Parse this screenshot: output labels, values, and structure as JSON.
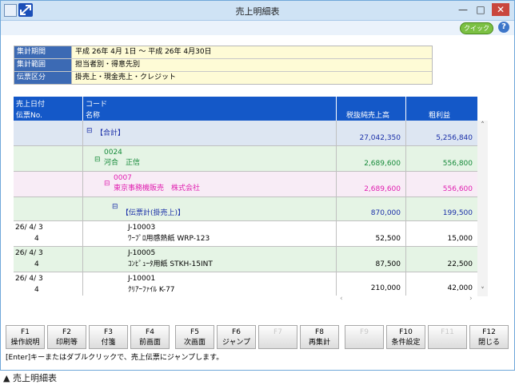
{
  "window": {
    "title": "売上明細表",
    "minimize": "—",
    "maximize": "□",
    "close": "✕",
    "quick_label": "クイック",
    "help_label": "?"
  },
  "info": [
    {
      "label": "集計期間",
      "value": "平成 26年 4月 1日 ～ 平成 26年 4月30日"
    },
    {
      "label": "集計範囲",
      "value": "担当者別・得意先別"
    },
    {
      "label": "伝票区分",
      "value": "掛売上・現金売上・クレジット"
    }
  ],
  "table": {
    "headers": {
      "col1_line1": "売上日付",
      "col1_line2": "伝票No.",
      "col2_line1": "コード",
      "col2_line2": "名称",
      "col3": "税抜純売上高",
      "col4": "粗利益"
    },
    "rows": [
      {
        "type": "group",
        "indent": 0,
        "code": "",
        "name": "【合計】",
        "sales": "27,042,350",
        "profit": "5,256,840"
      },
      {
        "type": "group",
        "indent": 1,
        "code": "0024",
        "name": "河合　正信",
        "sales": "2,689,600",
        "profit": "556,800"
      },
      {
        "type": "group",
        "indent": 2,
        "code": "0007",
        "name": "東京事務機販売　株式会社",
        "sales": "2,689,600",
        "profit": "556,600"
      },
      {
        "type": "group",
        "indent": 3,
        "code": "",
        "name": "【伝票計(掛売上)】",
        "sales": "870,000",
        "profit": "199,500"
      },
      {
        "type": "detail",
        "date": "26/ 4/ 3",
        "slip": "4",
        "code": "J-10003",
        "name": "ﾜｰﾌﾟﾛ用感熱紙 WRP-123",
        "sales": "52,500",
        "profit": "15,000"
      },
      {
        "type": "detail",
        "date": "26/ 4/ 3",
        "slip": "4",
        "code": "J-10005",
        "name": "ｺﾝﾋﾟｭｰﾀ用紙 STKH-15INT",
        "sales": "87,500",
        "profit": "22,500"
      },
      {
        "type": "detail",
        "date": "26/ 4/ 3",
        "slip": "4",
        "code": "J-10001",
        "name": "ｸﾘｱｰﾌｧｲﾙ K-77",
        "sales": "210,000",
        "profit": "42,000"
      }
    ],
    "scroll_up": "˄",
    "scroll_down": "˅",
    "scroll_left": "‹",
    "scroll_right": "›"
  },
  "fkeys": [
    {
      "key": "F1",
      "label": "操作説明",
      "enabled": true
    },
    {
      "key": "F2",
      "label": "印刷等",
      "enabled": true
    },
    {
      "key": "F3",
      "label": "付箋",
      "enabled": true
    },
    {
      "key": "F4",
      "label": "前画面",
      "enabled": true
    },
    {
      "key": "F5",
      "label": "次画面",
      "enabled": true
    },
    {
      "key": "F6",
      "label": "ジャンプ",
      "enabled": true
    },
    {
      "key": "F7",
      "label": "",
      "enabled": false
    },
    {
      "key": "F8",
      "label": "再集計",
      "enabled": true
    },
    {
      "key": "F9",
      "label": "",
      "enabled": false
    },
    {
      "key": "F10",
      "label": "条件設定",
      "enabled": true
    },
    {
      "key": "F11",
      "label": "",
      "enabled": false
    },
    {
      "key": "F12",
      "label": "閉じる",
      "enabled": true
    }
  ],
  "status_text": "[Enter]キーまたはダブルクリックで、売上伝票にジャンプします。",
  "caption": "▲ 売上明細表",
  "colors": {
    "header_blue": "#1458c8",
    "label_blue": "#3c6ab4",
    "info_yellow": "#fefbd6",
    "total_bg": "#dde6f2",
    "green_bg": "#e5f4e5",
    "pink_bg": "#f8ecf6",
    "blue_text": "#1a2fa8",
    "green_text": "#168a3a",
    "magenta_text": "#e020b0"
  }
}
